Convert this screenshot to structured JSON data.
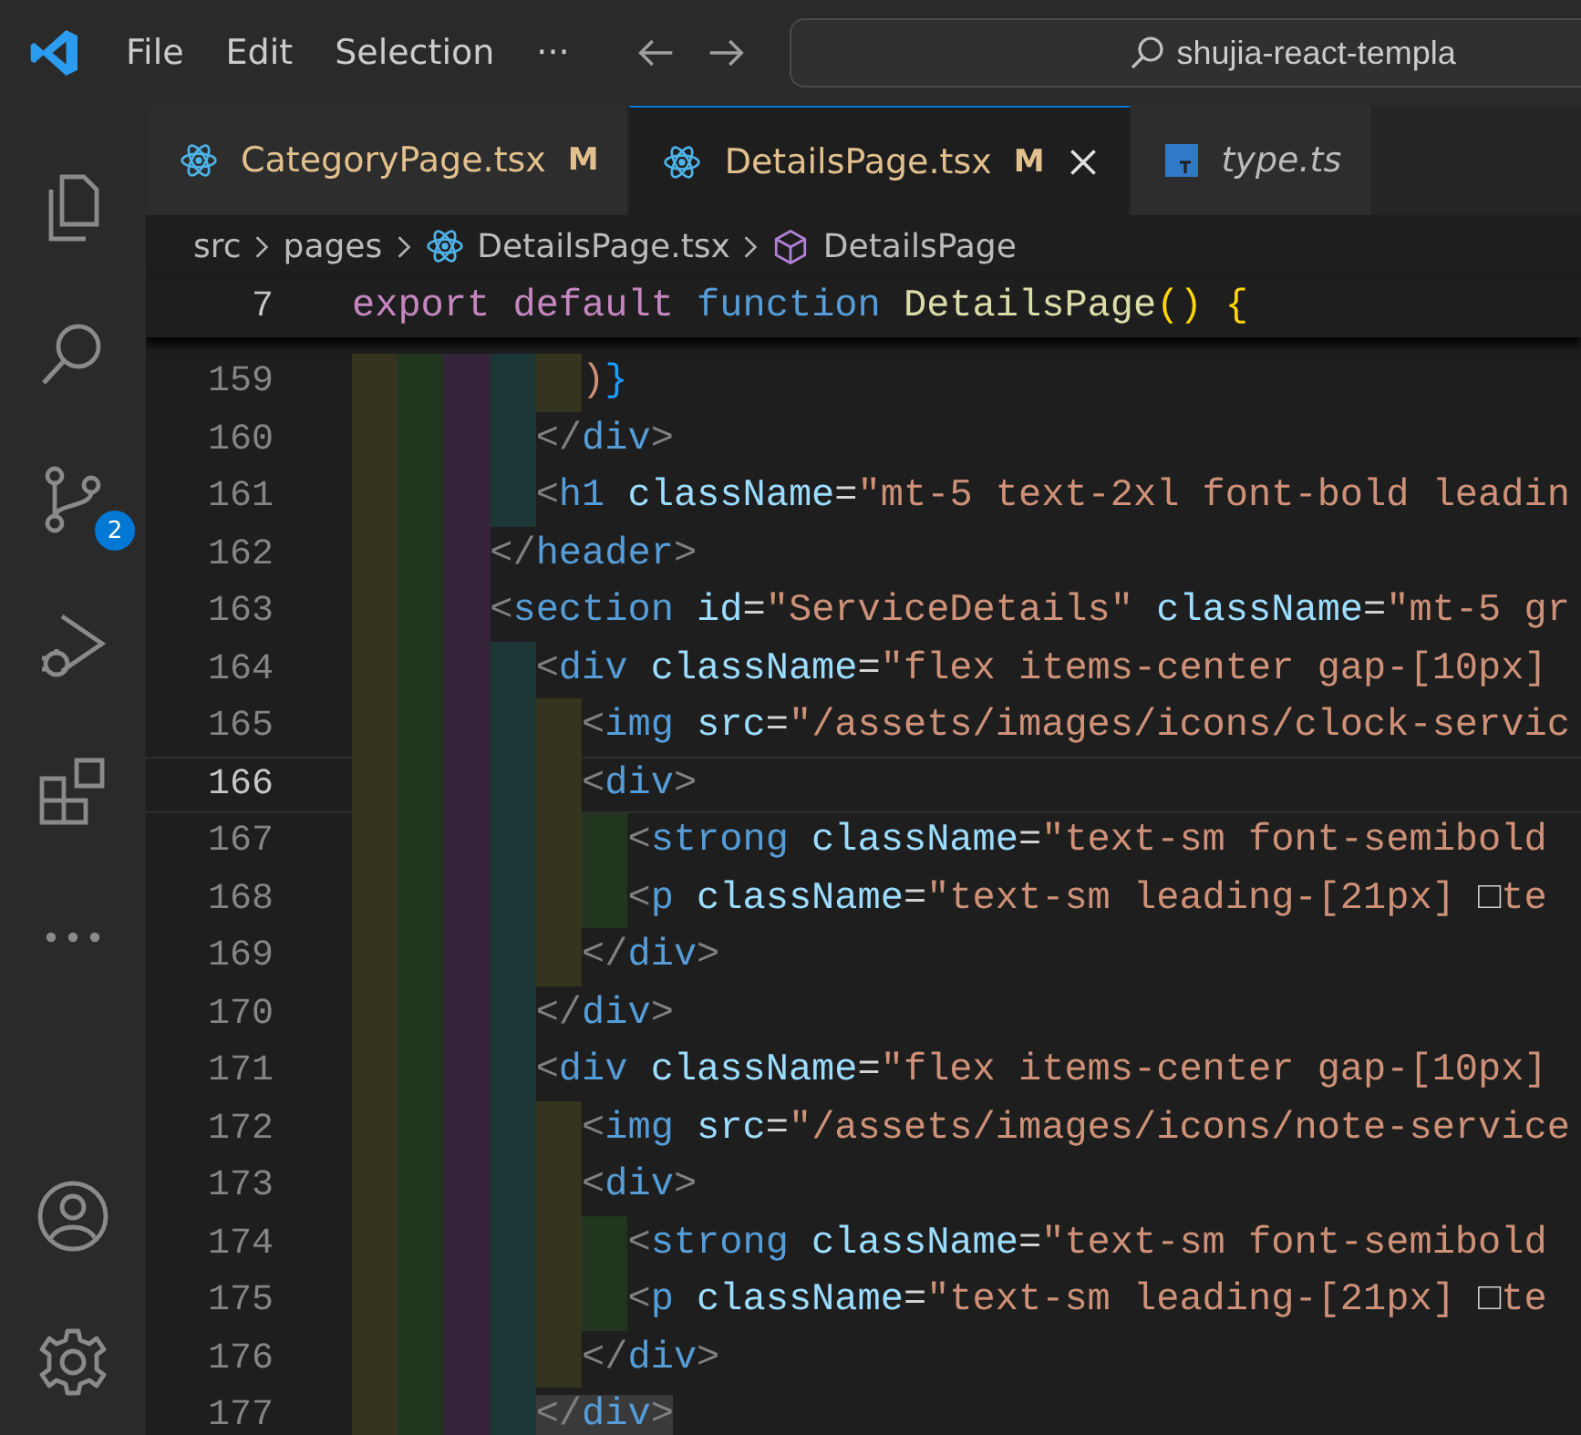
{
  "menu": [
    "File",
    "Edit",
    "Selection",
    "···"
  ],
  "search": {
    "value": "shujia-react-templa"
  },
  "activity_bar": [
    {
      "kind": "files",
      "selected": false
    },
    {
      "kind": "search",
      "selected": false
    },
    {
      "kind": "source-control",
      "selected": false,
      "badge": "2"
    },
    {
      "kind": "run-debug",
      "selected": false
    },
    {
      "kind": "extensions",
      "selected": false
    },
    {
      "kind": "more",
      "selected": false
    },
    {
      "kind": "account",
      "selected": false
    },
    {
      "kind": "settings",
      "selected": false
    }
  ],
  "tabs": [
    {
      "label": "CategoryPage.tsx",
      "badge": "M",
      "kind": "react",
      "selected": false,
      "preview": false
    },
    {
      "label": "DetailsPage.tsx",
      "badge": "M",
      "kind": "react",
      "selected": true,
      "preview": false
    },
    {
      "label": "type.ts",
      "kind": "ts",
      "selected": false,
      "preview": true
    }
  ],
  "breadcrumb": [
    {
      "label": "src",
      "kind": "folder"
    },
    {
      "label": "pages",
      "kind": "folder"
    },
    {
      "label": "DetailsPage.tsx",
      "kind": "react"
    },
    {
      "label": "DetailsPage",
      "kind": "symbol"
    }
  ],
  "sticky_line": {
    "number": "7",
    "tokens": [
      {
        "t": "export",
        "kind": "kw"
      },
      {
        "t": " default",
        "kind": "kw"
      },
      {
        "t": " function",
        "kind": "storage"
      },
      {
        "t": " DetailsPage",
        "kind": "fn"
      },
      {
        "t": "()",
        "kind": "b1"
      },
      {
        "t": " {",
        "kind": "b1"
      }
    ]
  },
  "lines": [
    {
      "number": "159",
      "current": false,
      "highlight": false,
      "tokens": [
        {
          "t": "          )",
          "kind": "b2"
        },
        {
          "t": "}",
          "kind": "b3"
        }
      ]
    },
    {
      "number": "160",
      "current": false,
      "highlight": false,
      "tokens": [
        {
          "t": "        </",
          "kind": "punct"
        },
        {
          "t": "div",
          "kind": "tag"
        },
        {
          "t": ">",
          "kind": "punct"
        }
      ]
    },
    {
      "number": "161",
      "current": false,
      "highlight": false,
      "tokens": [
        {
          "t": "        <",
          "kind": "punct"
        },
        {
          "t": "h1",
          "kind": "tag"
        },
        {
          "t": " className",
          "kind": "attr"
        },
        {
          "t": "=",
          "kind": "text"
        },
        {
          "t": "\"mt-5 text-2xl font-bold leadin",
          "kind": "str"
        }
      ]
    },
    {
      "number": "162",
      "current": false,
      "highlight": false,
      "tokens": [
        {
          "t": "      </",
          "kind": "punct"
        },
        {
          "t": "header",
          "kind": "tag"
        },
        {
          "t": ">",
          "kind": "punct"
        }
      ]
    },
    {
      "number": "163",
      "current": false,
      "highlight": false,
      "tokens": [
        {
          "t": "      <",
          "kind": "punct"
        },
        {
          "t": "section",
          "kind": "tag"
        },
        {
          "t": " id",
          "kind": "attr"
        },
        {
          "t": "=",
          "kind": "text"
        },
        {
          "t": "\"ServiceDetails\"",
          "kind": "str"
        },
        {
          "t": " className",
          "kind": "attr"
        },
        {
          "t": "=",
          "kind": "text"
        },
        {
          "t": "\"mt-5 gr",
          "kind": "str"
        }
      ]
    },
    {
      "number": "164",
      "current": false,
      "highlight": false,
      "tokens": [
        {
          "t": "        <",
          "kind": "punct"
        },
        {
          "t": "div",
          "kind": "tag"
        },
        {
          "t": " className",
          "kind": "attr"
        },
        {
          "t": "=",
          "kind": "text"
        },
        {
          "t": "\"flex items-center gap-[10px]",
          "kind": "str"
        }
      ]
    },
    {
      "number": "165",
      "current": false,
      "highlight": false,
      "tokens": [
        {
          "t": "          <",
          "kind": "punct"
        },
        {
          "t": "img",
          "kind": "tag"
        },
        {
          "t": " src",
          "kind": "attr"
        },
        {
          "t": "=",
          "kind": "text"
        },
        {
          "t": "\"/assets/images/icons/clock-servic",
          "kind": "str"
        }
      ]
    },
    {
      "number": "166",
      "current": true,
      "highlight": false,
      "tokens": [
        {
          "t": "          <",
          "kind": "punct"
        },
        {
          "t": "div",
          "kind": "tag"
        },
        {
          "t": ">",
          "kind": "punct"
        }
      ]
    },
    {
      "number": "167",
      "current": false,
      "highlight": false,
      "tokens": [
        {
          "t": "            <",
          "kind": "punct"
        },
        {
          "t": "strong",
          "kind": "tag"
        },
        {
          "t": " className",
          "kind": "attr"
        },
        {
          "t": "=",
          "kind": "text"
        },
        {
          "t": "\"text-sm font-semibold",
          "kind": "str"
        }
      ]
    },
    {
      "number": "168",
      "current": false,
      "highlight": false,
      "tokens": [
        {
          "t": "            <",
          "kind": "punct"
        },
        {
          "t": "p",
          "kind": "tag"
        },
        {
          "t": " className",
          "kind": "attr"
        },
        {
          "t": "=",
          "kind": "text"
        },
        {
          "t": "\"text-sm leading-[21px] ",
          "kind": "str"
        },
        {
          "t": "□",
          "kind": "glyph"
        },
        {
          "t": "te",
          "kind": "str"
        }
      ]
    },
    {
      "number": "169",
      "current": false,
      "highlight": false,
      "tokens": [
        {
          "t": "          </",
          "kind": "punct"
        },
        {
          "t": "div",
          "kind": "tag"
        },
        {
          "t": ">",
          "kind": "punct"
        }
      ]
    },
    {
      "number": "170",
      "current": false,
      "highlight": false,
      "tokens": [
        {
          "t": "        </",
          "kind": "punct"
        },
        {
          "t": "div",
          "kind": "tag"
        },
        {
          "t": ">",
          "kind": "punct"
        }
      ]
    },
    {
      "number": "171",
      "current": false,
      "highlight": false,
      "tokens": [
        {
          "t": "        <",
          "kind": "punct"
        },
        {
          "t": "div",
          "kind": "tag"
        },
        {
          "t": " className",
          "kind": "attr"
        },
        {
          "t": "=",
          "kind": "text"
        },
        {
          "t": "\"flex items-center gap-[10px]",
          "kind": "str"
        }
      ]
    },
    {
      "number": "172",
      "current": false,
      "highlight": false,
      "tokens": [
        {
          "t": "          <",
          "kind": "punct"
        },
        {
          "t": "img",
          "kind": "tag"
        },
        {
          "t": " src",
          "kind": "attr"
        },
        {
          "t": "=",
          "kind": "text"
        },
        {
          "t": "\"/assets/images/icons/note-service",
          "kind": "str"
        }
      ]
    },
    {
      "number": "173",
      "current": false,
      "highlight": false,
      "tokens": [
        {
          "t": "          <",
          "kind": "punct"
        },
        {
          "t": "div",
          "kind": "tag"
        },
        {
          "t": ">",
          "kind": "punct"
        }
      ]
    },
    {
      "number": "174",
      "current": false,
      "highlight": false,
      "tokens": [
        {
          "t": "            <",
          "kind": "punct"
        },
        {
          "t": "strong",
          "kind": "tag"
        },
        {
          "t": " className",
          "kind": "attr"
        },
        {
          "t": "=",
          "kind": "text"
        },
        {
          "t": "\"text-sm font-semibold",
          "kind": "str"
        }
      ]
    },
    {
      "number": "175",
      "current": false,
      "highlight": false,
      "tokens": [
        {
          "t": "            <",
          "kind": "punct"
        },
        {
          "t": "p",
          "kind": "tag"
        },
        {
          "t": " className",
          "kind": "attr"
        },
        {
          "t": "=",
          "kind": "text"
        },
        {
          "t": "\"text-sm leading-[21px] ",
          "kind": "str"
        },
        {
          "t": "□",
          "kind": "glyph"
        },
        {
          "t": "te",
          "kind": "str"
        }
      ]
    },
    {
      "number": "176",
      "current": false,
      "highlight": false,
      "tokens": [
        {
          "t": "          </",
          "kind": "punct"
        },
        {
          "t": "div",
          "kind": "tag"
        },
        {
          "t": ">",
          "kind": "punct"
        }
      ]
    },
    {
      "number": "177",
      "current": false,
      "highlight": true,
      "tokens": [
        {
          "t": "        </",
          "kind": "punct"
        },
        {
          "t": "div",
          "kind": "tag"
        },
        {
          "t": ">",
          "kind": "punct"
        }
      ]
    }
  ]
}
